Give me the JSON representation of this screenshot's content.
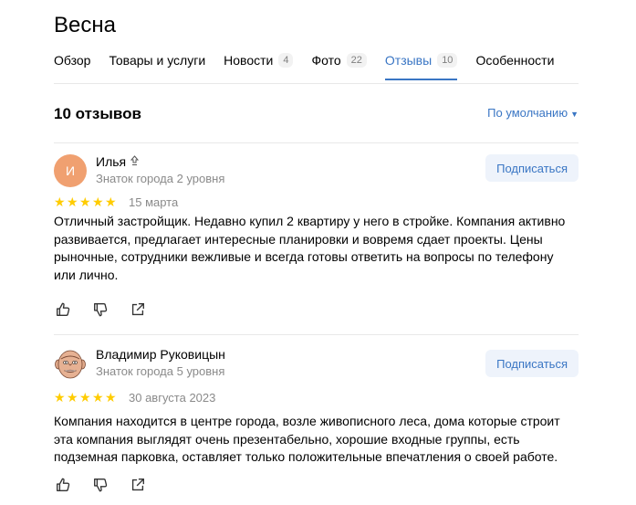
{
  "header": {
    "title": "Весна"
  },
  "tabs": [
    {
      "label": "Обзор",
      "count": ""
    },
    {
      "label": "Товары и услуги",
      "count": ""
    },
    {
      "label": "Новости",
      "count": "4"
    },
    {
      "label": "Фото",
      "count": "22"
    },
    {
      "label": "Отзывы",
      "count": "10"
    },
    {
      "label": "Особенности",
      "count": ""
    }
  ],
  "active_tab": "Отзывы",
  "reviews_header": {
    "count_label": "10 отзывов",
    "sort_label": "По умолчанию"
  },
  "reviews": [
    {
      "avatar_letter": "И",
      "author": "Илья",
      "level": "Знаток города 2 уровня",
      "subscribe_label": "Подписаться",
      "rating": 5,
      "date": "15 марта",
      "text": "Отличный застройщик. Недавно купил 2 квартиру у него в стройке. Компания активно развивается, предлагает интересные планировки и вовремя сдает проекты. Цены рыночные, сотрудники вежливые и всегда готовы ответить на вопросы по телефону или лично."
    },
    {
      "avatar_letter": "",
      "author": "Владимир Руковицын",
      "level": "Знаток города 5 уровня",
      "subscribe_label": "Подписаться",
      "rating": 5,
      "date": "30 августа 2023",
      "text": "Компания находится в центре города, возле живописного леса, дома которые строит эта компания выглядят очень презентабельно, хорошие входные группы, есть подземная парковка, оставляет только положительные впечатления о своей работе."
    }
  ],
  "icons": {
    "like": "thumbs-up-icon",
    "dislike": "thumbs-down-icon",
    "share": "share-icon",
    "badge": "expert-badge-icon"
  },
  "colors": {
    "accent": "#3a76c4",
    "star": "#ffcc00",
    "avatar": "#f0a070",
    "subscribe_bg": "#eef3fb"
  }
}
